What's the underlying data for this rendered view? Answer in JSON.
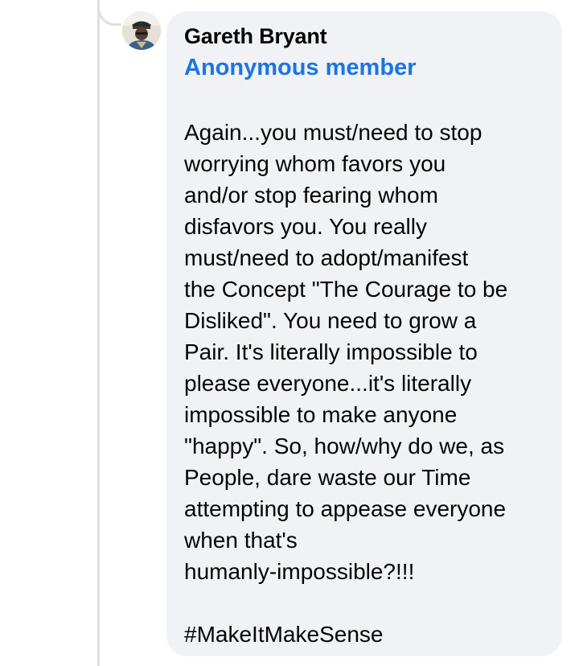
{
  "comment": {
    "author": "Gareth Bryant",
    "badge": "Anonymous member",
    "lines": [
      "Again...you must/need to stop",
      "worrying whom favors you",
      "and/or stop fearing whom",
      "disfavors you. You really",
      "must/need to adopt/manifest",
      "the Concept \"The Courage to be",
      "Disliked\". You need to grow a",
      "Pair. It's literally impossible to",
      "please everyone...it's literally",
      "impossible to make anyone",
      "\"happy\". So, how/why do we, as",
      "People, dare waste our Time",
      "attempting to appease everyone",
      "when that's",
      "humanly-impossible?!!!"
    ],
    "hashtag": "#MakeItMakeSense"
  },
  "colors": {
    "bubble_bg": "#f0f2f5",
    "badge_blue": "#1b74e4",
    "thread_line": "#dcdfe3"
  },
  "icons": {
    "avatar": "profile-photo"
  }
}
